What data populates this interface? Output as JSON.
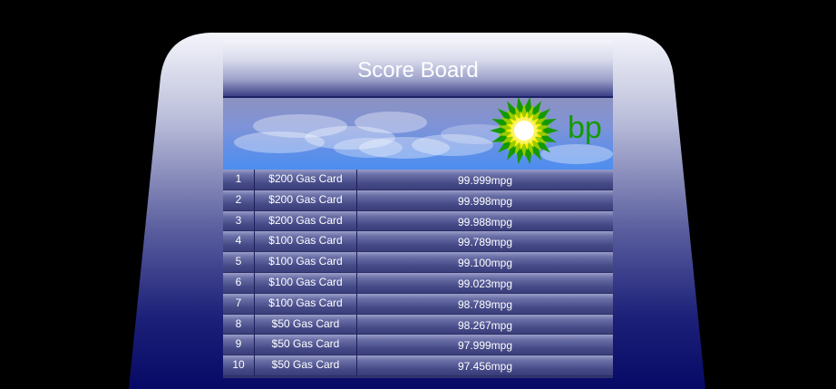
{
  "scoreboard": {
    "title": "Score Board",
    "brand": {
      "logo_text": "bp",
      "logo_colors": {
        "outer": "#149a00",
        "mid": "#99cc00",
        "inner": "#ffee00",
        "core": "#ffffff"
      }
    },
    "rows": [
      {
        "rank": "1",
        "prize": "$200 Gas Card",
        "score": "99.999mpg"
      },
      {
        "rank": "2",
        "prize": "$200 Gas Card",
        "score": "99.998mpg"
      },
      {
        "rank": "3",
        "prize": "$200 Gas Card",
        "score": "99.988mpg"
      },
      {
        "rank": "4",
        "prize": "$100 Gas Card",
        "score": "99.789mpg"
      },
      {
        "rank": "5",
        "prize": "$100 Gas Card",
        "score": "99.100mpg"
      },
      {
        "rank": "6",
        "prize": "$100 Gas Card",
        "score": "99.023mpg"
      },
      {
        "rank": "7",
        "prize": "$100 Gas Card",
        "score": "98.789mpg"
      },
      {
        "rank": "8",
        "prize": "$50 Gas Card",
        "score": "98.267mpg"
      },
      {
        "rank": "9",
        "prize": "$50 Gas Card",
        "score": "97.999mpg"
      },
      {
        "rank": "10",
        "prize": "$50 Gas Card",
        "score": "97.456mpg"
      }
    ]
  }
}
